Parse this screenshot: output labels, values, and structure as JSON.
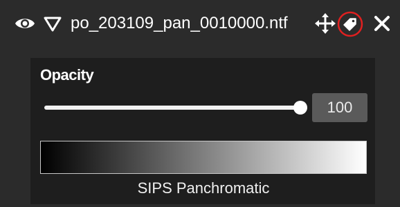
{
  "header": {
    "layer_name": "po_203109_pan_0010000.ntf",
    "icons": {
      "visibility": "eye-icon",
      "collapse": "triangle-down-icon",
      "move": "move-arrows-icon",
      "tag": "tag-icon",
      "close": "close-icon"
    },
    "tag_highlight_color": "#e02020"
  },
  "opacity": {
    "label": "Opacity",
    "value": "100",
    "fraction": 1.0
  },
  "colormap": {
    "name": "SIPS Panchromatic",
    "gradient_start": "#000000",
    "gradient_end": "#ffffff"
  }
}
